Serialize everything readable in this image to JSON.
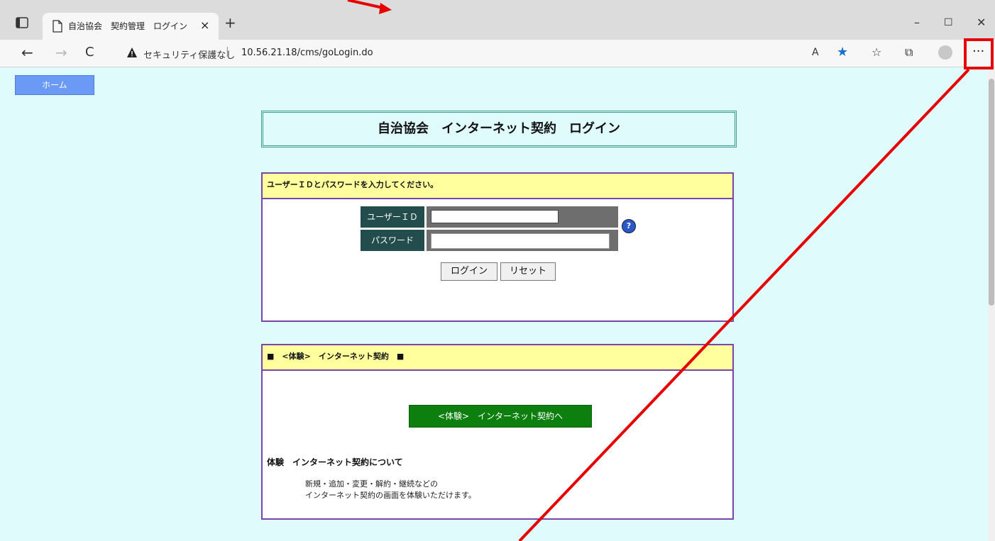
{
  "browser": {
    "tab_title": "自治協会　契約管理　ログイン",
    "tab_close": "×",
    "new_tab": "+",
    "window_controls": {
      "minimize": "–",
      "maximize": "☐",
      "close": "✕"
    },
    "nav": {
      "back": "←",
      "forward": "→",
      "refresh": "C"
    },
    "security_label": "セキュリティ保護なし",
    "separator": "|",
    "url": "10.56.21.18/cms/goLogin.do",
    "toolbar": {
      "read_aloud": "A",
      "favorite": "★",
      "favorites_list": "☆",
      "collections": "⧉",
      "more": "···"
    }
  },
  "page": {
    "home_button": "ホーム",
    "title": "自治協会　インターネット契約　ログイン",
    "login_panel": {
      "header": "ユーザーＩＤとパスワードを入力してください。",
      "userid_label": "ユーザーＩＤ",
      "userid_value": "",
      "password_label": "パスワード",
      "password_value": "",
      "help_icon": "?",
      "login_button": "ログイン",
      "reset_button": "リセット"
    },
    "trial_panel": {
      "header": "■　<体験>　インターネット契約　■",
      "trial_button": "<体験>　インターネット契約へ",
      "about_title": "体験　インターネット契約について",
      "about_line1": "新規・追加・変更・解約・継続などの",
      "about_line2": "インターネット契約の画面を体験いただけます。"
    }
  },
  "annotation": {
    "color": "#e60000"
  }
}
